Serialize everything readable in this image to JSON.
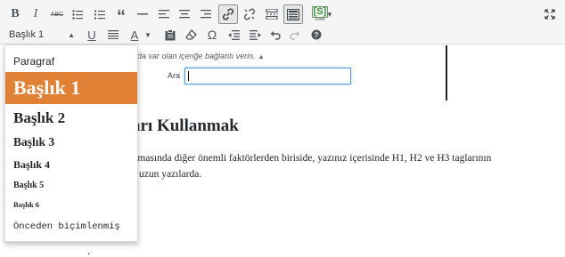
{
  "toolbar": {
    "row1": [
      {
        "name": "bold-button",
        "glyph": "B"
      },
      {
        "name": "italic-button",
        "glyph": "I"
      },
      {
        "name": "strikethrough-button",
        "glyph": "ABC"
      },
      {
        "name": "bullet-list-button",
        "icon": "bullet-list-icon"
      },
      {
        "name": "numbered-list-button",
        "icon": "numbered-list-icon"
      },
      {
        "name": "blockquote-button",
        "glyph": "“"
      },
      {
        "name": "horizontal-line-button",
        "icon": "horizontal-line-icon"
      },
      {
        "name": "align-left-button",
        "icon": "align-left-icon"
      },
      {
        "name": "align-center-button",
        "icon": "align-center-icon"
      },
      {
        "name": "align-right-button",
        "icon": "align-right-icon"
      },
      {
        "name": "insert-link-button",
        "icon": "link-icon",
        "active": true
      },
      {
        "name": "remove-link-button",
        "icon": "unlink-icon"
      },
      {
        "name": "read-more-button",
        "icon": "read-more-icon"
      },
      {
        "name": "toolbar-toggle-button",
        "icon": "kitchen-sink-icon",
        "active": true
      }
    ],
    "shortcode_label": "[S]",
    "shortcode_sub": "code",
    "format_select_value": "Başlık 1",
    "underline_glyph": "U",
    "text_color_glyph": "A",
    "special_char_glyph": "Ω"
  },
  "link_panel": {
    "hint": "da var olan içeriğe bağlantı verin.",
    "hint_marker": "▲",
    "search_label": "Ara",
    "search_value": ""
  },
  "content": {
    "heading": "arı Kullanmak",
    "line1": "ılmasında diğer önemli faktörlerden biriside, yazınız içerisinde H1, H2 ve H3 taglarının",
    "line2": "e uzun yazılarda.",
    "stray": "."
  },
  "dropdown": {
    "items": [
      {
        "label": "Paragraf"
      },
      {
        "label": "Başlık 1",
        "selected": true
      },
      {
        "label": "Başlık 2"
      },
      {
        "label": "Başlık 3"
      },
      {
        "label": "Başlık 4"
      },
      {
        "label": "Başlık 5"
      },
      {
        "label": "Başlık 6"
      },
      {
        "label": "Önceden biçimlenmiş"
      }
    ]
  },
  "colors": {
    "selected_item_bg": "#e08136",
    "toolbar_bg": "#f5f5f5",
    "input_focus": "#5b9dd9"
  }
}
